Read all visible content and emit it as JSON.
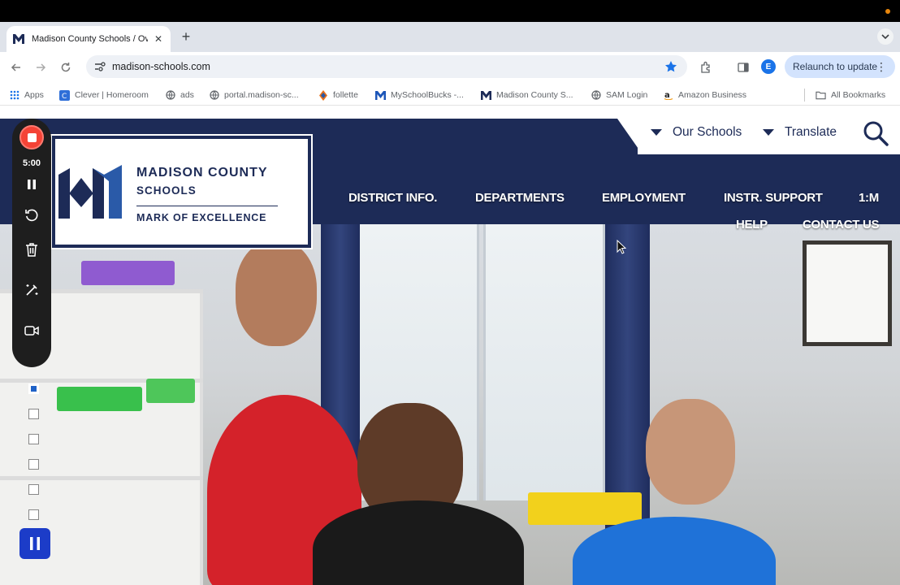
{
  "browser": {
    "tab": {
      "title": "Madison County Schools / Ov",
      "favicon": "madison-m-logo"
    },
    "url": "madison-schools.com",
    "profile_initial": "E",
    "relaunch_label": "Relaunch to update",
    "bookmarks": [
      {
        "label": "Apps",
        "icon": "apps-grid-icon"
      },
      {
        "label": "Clever | Homeroom",
        "icon": "clever-icon"
      },
      {
        "label": "ads",
        "icon": "globe-icon"
      },
      {
        "label": "portal.madison-sc...",
        "icon": "globe-icon"
      },
      {
        "label": "follette",
        "icon": "follett-icon"
      },
      {
        "label": "MySchoolBucks -...",
        "icon": "m-icon"
      },
      {
        "label": "Madison County S...",
        "icon": "madison-m-logo"
      },
      {
        "label": "SAM Login",
        "icon": "globe-icon"
      },
      {
        "label": "Amazon Business",
        "icon": "amazon-icon"
      }
    ],
    "all_bookmarks_label": "All Bookmarks"
  },
  "site": {
    "top_links": {
      "our_schools": "Our Schools",
      "translate": "Translate"
    },
    "logo": {
      "line1": "MADISON COUNTY",
      "line2": "SCHOOLS",
      "tagline": "MARK OF EXCELLENCE"
    },
    "nav": {
      "district_info": "DISTRICT INFO.",
      "departments": "DEPARTMENTS",
      "employment": "EMPLOYMENT",
      "instr_support": "INSTR. SUPPORT",
      "one_m": "1:M",
      "help": "HELP",
      "contact_us": "CONTACT US"
    }
  },
  "recorder": {
    "time": "5:00"
  },
  "colors": {
    "brand_navy": "#1d2b57",
    "brand_blue": "#2a5aa8",
    "record_red": "#f44336"
  }
}
